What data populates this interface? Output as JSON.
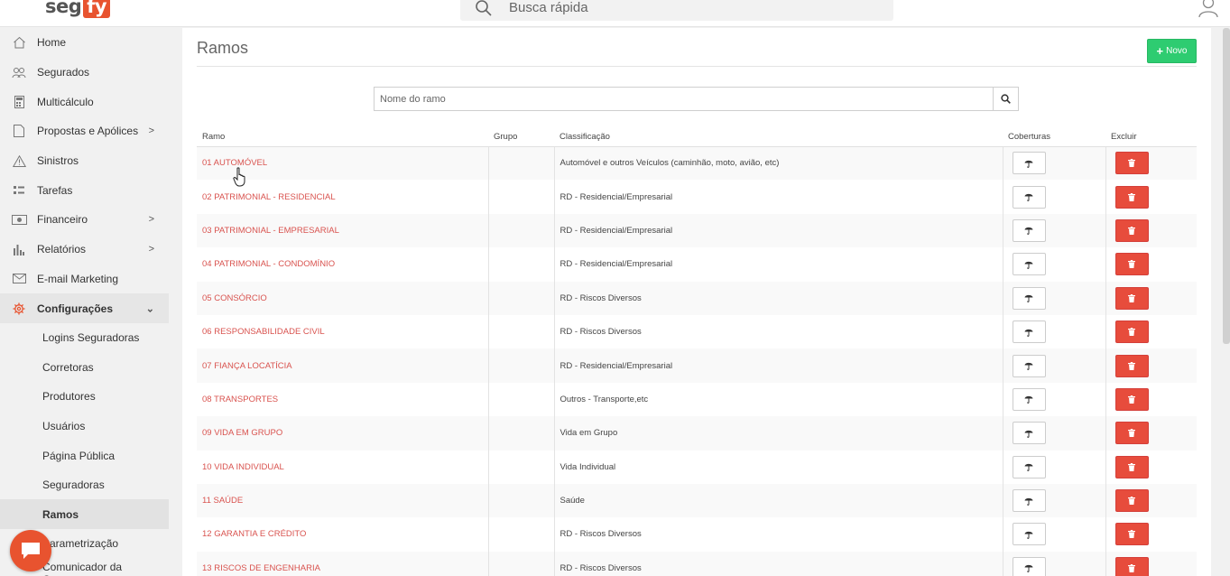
{
  "header": {
    "logo_left": "seg",
    "logo_right": "fy",
    "search_placeholder": "Busca rápida"
  },
  "sidebar": {
    "items": [
      {
        "label": "Home",
        "icon": "home-icon"
      },
      {
        "label": "Segurados",
        "icon": "users-icon"
      },
      {
        "label": "Multicálculo",
        "icon": "calculator-icon"
      },
      {
        "label": "Propostas e Apólices",
        "icon": "document-icon",
        "chevron": ">"
      },
      {
        "label": "Sinistros",
        "icon": "warning-icon"
      },
      {
        "label": "Tarefas",
        "icon": "tasks-icon"
      },
      {
        "label": "Financeiro",
        "icon": "money-icon",
        "chevron": ">"
      },
      {
        "label": "Relatórios",
        "icon": "bar-chart-icon",
        "chevron": ">"
      },
      {
        "label": "E-mail Marketing",
        "icon": "mail-icon"
      },
      {
        "label": "Configurações",
        "icon": "gear-icon",
        "chevron": "⌄"
      }
    ],
    "subitems": [
      "Logins Seguradoras",
      "Corretoras",
      "Produtores",
      "Usuários",
      "Página Pública",
      "Seguradoras",
      "Ramos",
      "Parametrização",
      "Comunicador da Corretora"
    ]
  },
  "main": {
    "title": "Ramos",
    "new_button": "Novo",
    "filter_placeholder": "Nome do ramo",
    "columns": [
      "Ramo",
      "Grupo",
      "Classificação",
      "Coberturas",
      "Excluir"
    ],
    "rows": [
      {
        "ramo": "01 AUTOMÓVEL",
        "grupo": "",
        "classificacao": "Automóvel e outros Veículos (caminhão, moto, avião, etc)"
      },
      {
        "ramo": "02 PATRIMONIAL - RESIDENCIAL",
        "grupo": "",
        "classificacao": "RD - Residencial/Empresarial"
      },
      {
        "ramo": "03 PATRIMONIAL - EMPRESARIAL",
        "grupo": "",
        "classificacao": "RD - Residencial/Empresarial"
      },
      {
        "ramo": "04 PATRIMONIAL - CONDOMÍNIO",
        "grupo": "",
        "classificacao": "RD - Residencial/Empresarial"
      },
      {
        "ramo": "05 CONSÓRCIO",
        "grupo": "",
        "classificacao": "RD - Riscos Diversos"
      },
      {
        "ramo": "06 RESPONSABILIDADE CIVIL",
        "grupo": "",
        "classificacao": "RD - Riscos Diversos"
      },
      {
        "ramo": "07 FIANÇA LOCATÍCIA",
        "grupo": "",
        "classificacao": "RD - Residencial/Empresarial"
      },
      {
        "ramo": "08 TRANSPORTES",
        "grupo": "",
        "classificacao": "Outros - Transporte,etc"
      },
      {
        "ramo": "09 VIDA EM GRUPO",
        "grupo": "",
        "classificacao": "Vida em Grupo"
      },
      {
        "ramo": "10 VIDA INDIVIDUAL",
        "grupo": "",
        "classificacao": "Vida Individual"
      },
      {
        "ramo": "11 SAÚDE",
        "grupo": "",
        "classificacao": "Saúde"
      },
      {
        "ramo": "12 GARANTIA E CRÉDITO",
        "grupo": "",
        "classificacao": "RD - Riscos Diversos"
      },
      {
        "ramo": "13 RISCOS DE ENGENHARIA",
        "grupo": "",
        "classificacao": "RD - Riscos Diversos"
      }
    ]
  },
  "colors": {
    "brand": "#e8532f",
    "new_button": "#2ecc71",
    "delete_button": "#e74c3c",
    "link": "#d9534f"
  }
}
